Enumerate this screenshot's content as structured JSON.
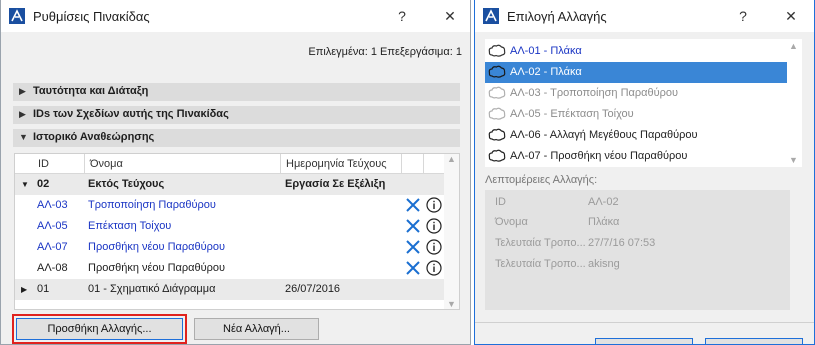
{
  "left_window": {
    "title": "Ρυθμίσεις Πινακίδας",
    "help_glyph": "?",
    "close_glyph": "✕",
    "info_line": "Επιλεγμένα: 1 Επεξεργάσιμα: 1",
    "sections": [
      {
        "label": "Ταυτότητα και Διάταξη",
        "expanded": false
      },
      {
        "label": "IDs των Σχεδίων αυτής της Πινακίδας",
        "expanded": false
      },
      {
        "label": "Ιστορικό Αναθεώρησης",
        "expanded": true
      }
    ],
    "table": {
      "headers": [
        "ID",
        "Όνομα",
        "Ημερομηνία Τεύχους"
      ],
      "group1": {
        "id": "02",
        "name": "Εκτός Τεύχους",
        "date": "Εργασία Σε Εξέλιξη"
      },
      "rows": [
        {
          "id": "ΑΛ-03",
          "name": "Τροποποίηση Παραθύρου",
          "linked": true
        },
        {
          "id": "ΑΛ-05",
          "name": "Επέκταση Τοίχου",
          "linked": true
        },
        {
          "id": "ΑΛ-07",
          "name": "Προσθήκη νέου Παραθύρου",
          "linked": true
        },
        {
          "id": "ΑΛ-08",
          "name": "Προσθήκη νέου Παραθύρου",
          "linked": false
        }
      ],
      "group2": {
        "id": "01",
        "name": "01 - Σχηματικό Διάγραμμα",
        "date": "26/07/2016"
      }
    },
    "buttons": {
      "add_change": "Προσθήκη Αλλαγής...",
      "new_change": "Νέα Αλλαγή..."
    }
  },
  "right_window": {
    "title": "Επιλογή Αλλαγής",
    "help_glyph": "?",
    "close_glyph": "✕",
    "list": [
      {
        "label": "ΑΛ-01 - Πλάκα",
        "style": "blue"
      },
      {
        "label": "ΑΛ-02 - Πλάκα",
        "style": "selected"
      },
      {
        "label": "ΑΛ-03 - Τροποποίηση Παραθύρου",
        "style": "dim"
      },
      {
        "label": "ΑΛ-05 - Επέκταση Τοίχου",
        "style": "dim"
      },
      {
        "label": "ΑΛ-06 - Αλλαγή Μεγέθους Παραθύρου",
        "style": "normal"
      },
      {
        "label": "ΑΛ-07 - Προσθήκη νέου Παραθύρου",
        "style": "normal"
      }
    ],
    "details_label": "Λεπτομέρειες Αλλαγής:",
    "details": [
      {
        "key": "ID",
        "value": "ΑΛ-02"
      },
      {
        "key": "Όνομα",
        "value": "Πλάκα"
      },
      {
        "key": "Τελευταία Τροπο...",
        "value": "27/7/16 07:53"
      },
      {
        "key": "Τελευταία Τροπο...",
        "value": "akisng"
      }
    ]
  },
  "colors": {
    "link_blue": "#1a35c4",
    "selection_blue": "#3a86d6",
    "delete_x_blue": "#1a6fd1",
    "focus_red": "#e0221e"
  }
}
